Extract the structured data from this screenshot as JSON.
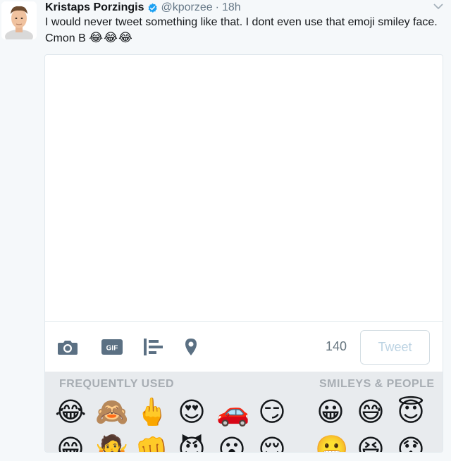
{
  "tweet": {
    "author_name": "Kristaps Porzingis",
    "handle": "@kporzee",
    "separator": "·",
    "time": "18h",
    "text_line1": "I would never tweet something like that. I dont even use that emoji smiley face.",
    "text_line2": "Cmon B",
    "emojis": "😂😂😂"
  },
  "composer": {
    "char_count": "140",
    "tweet_button_label": "Tweet",
    "tool_icons": [
      "camera-icon",
      "gif-icon",
      "poll-icon",
      "location-pin-icon"
    ],
    "gif_badge": "GIF"
  },
  "emoji_picker": {
    "sections": [
      "FREQUENTLY USED",
      "SMILEYS & PEOPLE"
    ],
    "row1": [
      "😂",
      "🙈",
      "🖕",
      "😍",
      "🚗",
      "😏",
      "😀",
      "😅",
      "😇"
    ],
    "row2": [
      "😁",
      "🤷",
      "👊",
      "😈",
      "😮",
      "😌",
      "😬",
      "😆",
      "😯"
    ]
  },
  "colors": {
    "background": "#f5f8fa",
    "verified_blue": "#1da1f2",
    "muted_text": "#657786",
    "tweet_button_text": "#bcd3e3",
    "emoji_panel_bg": "#e8ebee",
    "section_label": "#a7adb3",
    "icon_gray": "#5b7083"
  }
}
